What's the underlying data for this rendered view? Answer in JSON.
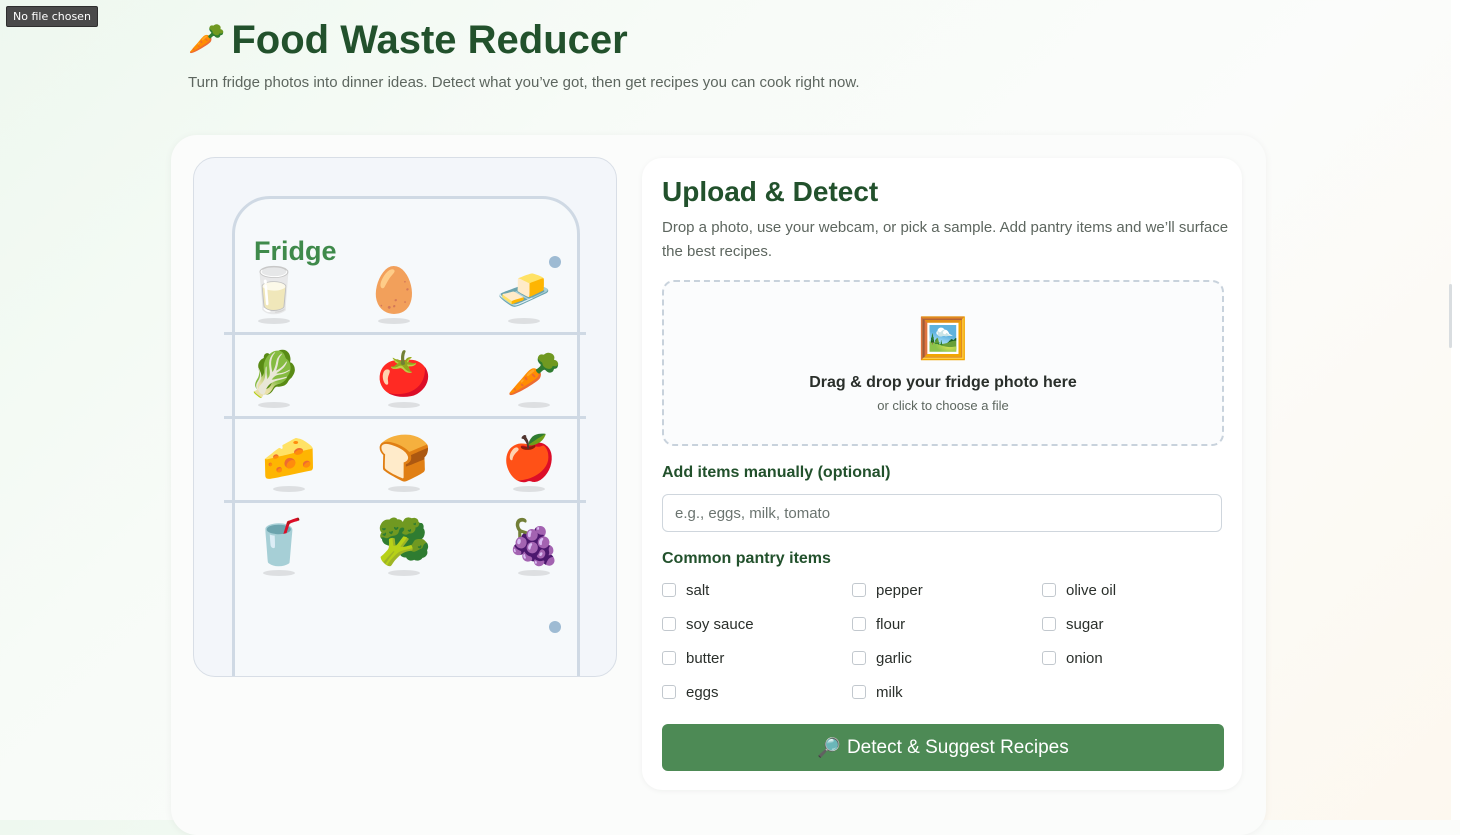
{
  "file_input": {
    "tooltip": "No file chosen"
  },
  "header": {
    "icon": "🥕",
    "title": "Food Waste Reducer",
    "subtitle": "Turn fridge photos into dinner ideas. Detect what you’ve got, then get recipes you can cook right now."
  },
  "fridge": {
    "label": "Fridge",
    "items": [
      {
        "name": "milk-glass",
        "glyph": "🥛"
      },
      {
        "name": "egg",
        "glyph": "🥚"
      },
      {
        "name": "butter",
        "glyph": "🧈"
      },
      {
        "name": "lettuce",
        "glyph": "🥬"
      },
      {
        "name": "tomato",
        "glyph": "🍅"
      },
      {
        "name": "carrot",
        "glyph": "🥕"
      },
      {
        "name": "cheese",
        "glyph": "🧀"
      },
      {
        "name": "bread",
        "glyph": "🍞"
      },
      {
        "name": "apple",
        "glyph": "🍎"
      },
      {
        "name": "drink-cup",
        "glyph": "🥤"
      },
      {
        "name": "broccoli",
        "glyph": "🥦"
      },
      {
        "name": "grapes",
        "glyph": "🍇"
      }
    ]
  },
  "upload": {
    "title": "Upload & Detect",
    "description": "Drop a photo, use your webcam, or pick a sample. Add pantry items and we’ll surface the best recipes.",
    "dropzone": {
      "icon": "🖼️",
      "main_text": "Drag & drop your fridge photo here",
      "sub_text": "or click to choose a file"
    },
    "manual": {
      "label": "Add items manually (optional)",
      "placeholder": "e.g., eggs, milk, tomato"
    },
    "pantry": {
      "label": "Common pantry items",
      "items": [
        {
          "label": "salt",
          "checked": false
        },
        {
          "label": "pepper",
          "checked": false
        },
        {
          "label": "olive oil",
          "checked": false
        },
        {
          "label": "soy sauce",
          "checked": false
        },
        {
          "label": "flour",
          "checked": false
        },
        {
          "label": "sugar",
          "checked": false
        },
        {
          "label": "butter",
          "checked": false
        },
        {
          "label": "garlic",
          "checked": false
        },
        {
          "label": "onion",
          "checked": false
        },
        {
          "label": "eggs",
          "checked": false
        },
        {
          "label": "milk",
          "checked": false
        }
      ]
    },
    "button": {
      "icon": "🔎",
      "label": "Detect & Suggest Recipes"
    }
  },
  "colors": {
    "brand_green": "#22512c",
    "button_green": "#4d8a55",
    "fridge_label_green": "#3f8a4b"
  }
}
